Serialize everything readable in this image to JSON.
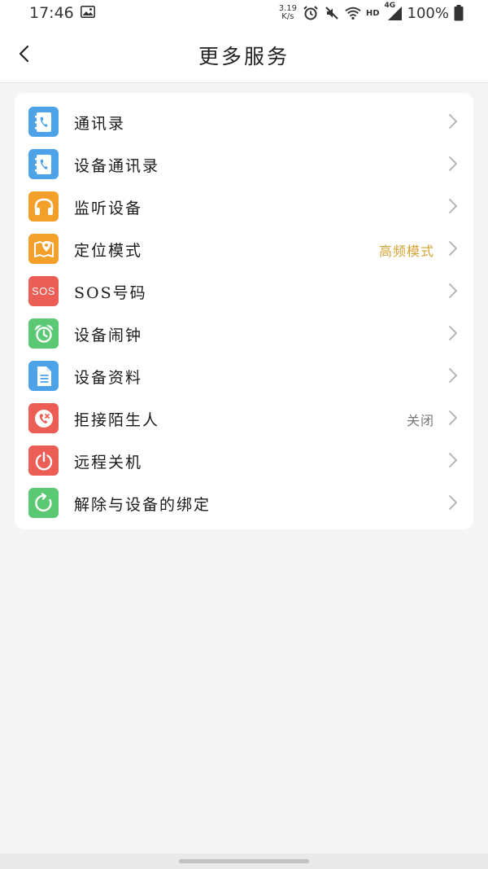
{
  "status_bar": {
    "time": "17:46",
    "net_speed_value": "3.19",
    "net_speed_unit": "K/s",
    "hd": "HD",
    "network": "4G",
    "battery": "100%"
  },
  "header": {
    "title": "更多服务"
  },
  "menu": {
    "items": [
      {
        "label": "通讯录",
        "icon": "contacts-icon",
        "value": ""
      },
      {
        "label": "设备通讯录",
        "icon": "device-contacts-icon",
        "value": ""
      },
      {
        "label": "监听设备",
        "icon": "headphones-icon",
        "value": ""
      },
      {
        "label": "定位模式",
        "icon": "map-pin-icon",
        "value": "高频模式"
      },
      {
        "label": "SOS号码",
        "icon": "sos-icon",
        "value": "",
        "icon_text": "SOS"
      },
      {
        "label": "设备闹钟",
        "icon": "alarm-clock-icon",
        "value": ""
      },
      {
        "label": "设备资料",
        "icon": "document-icon",
        "value": ""
      },
      {
        "label": "拒接陌生人",
        "icon": "reject-call-icon",
        "value": "关闭"
      },
      {
        "label": "远程关机",
        "icon": "power-icon",
        "value": ""
      },
      {
        "label": "解除与设备的绑定",
        "icon": "unbind-icon",
        "value": ""
      }
    ]
  },
  "colors": {
    "blue": "#4ea3e8",
    "orange": "#f3a02a",
    "red": "#ec5d56",
    "green": "#5bc874",
    "value_highlight": "#d4a233",
    "value_muted": "#777777"
  }
}
